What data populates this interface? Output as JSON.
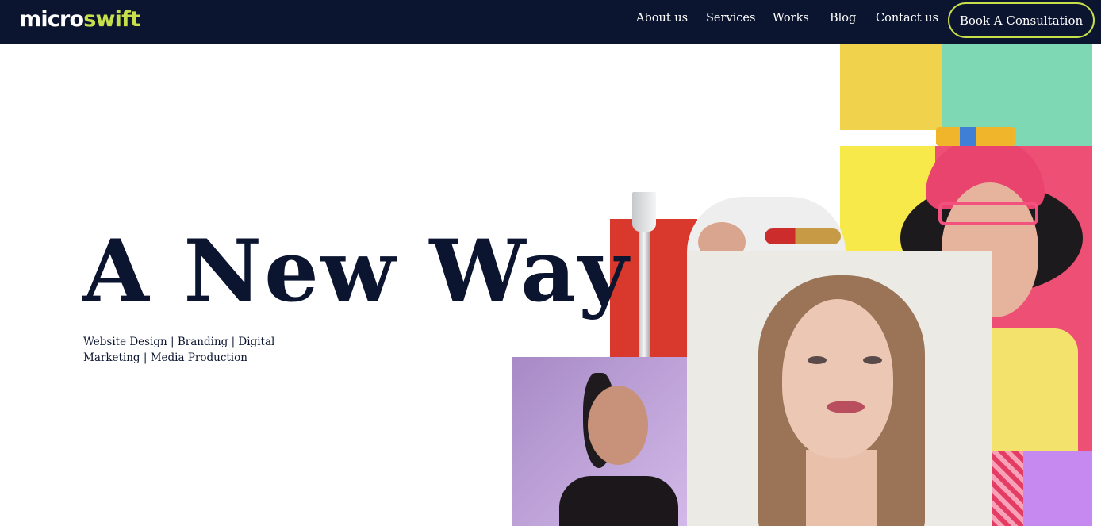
{
  "brand": {
    "logo_part1": "micro",
    "logo_part2": "swift"
  },
  "nav": {
    "items": [
      {
        "label": "About us"
      },
      {
        "label": "Services"
      },
      {
        "label": "Works"
      },
      {
        "label": "Blog"
      },
      {
        "label": "Contact us"
      }
    ],
    "cta_label": "Book A Consultation"
  },
  "hero": {
    "title": "A New Way",
    "subtitle": "Website Design | Branding | Digital Marketing | Media Production"
  },
  "colors": {
    "navy": "#0c1530",
    "accent_green": "#c7df4b",
    "white": "#ffffff"
  }
}
